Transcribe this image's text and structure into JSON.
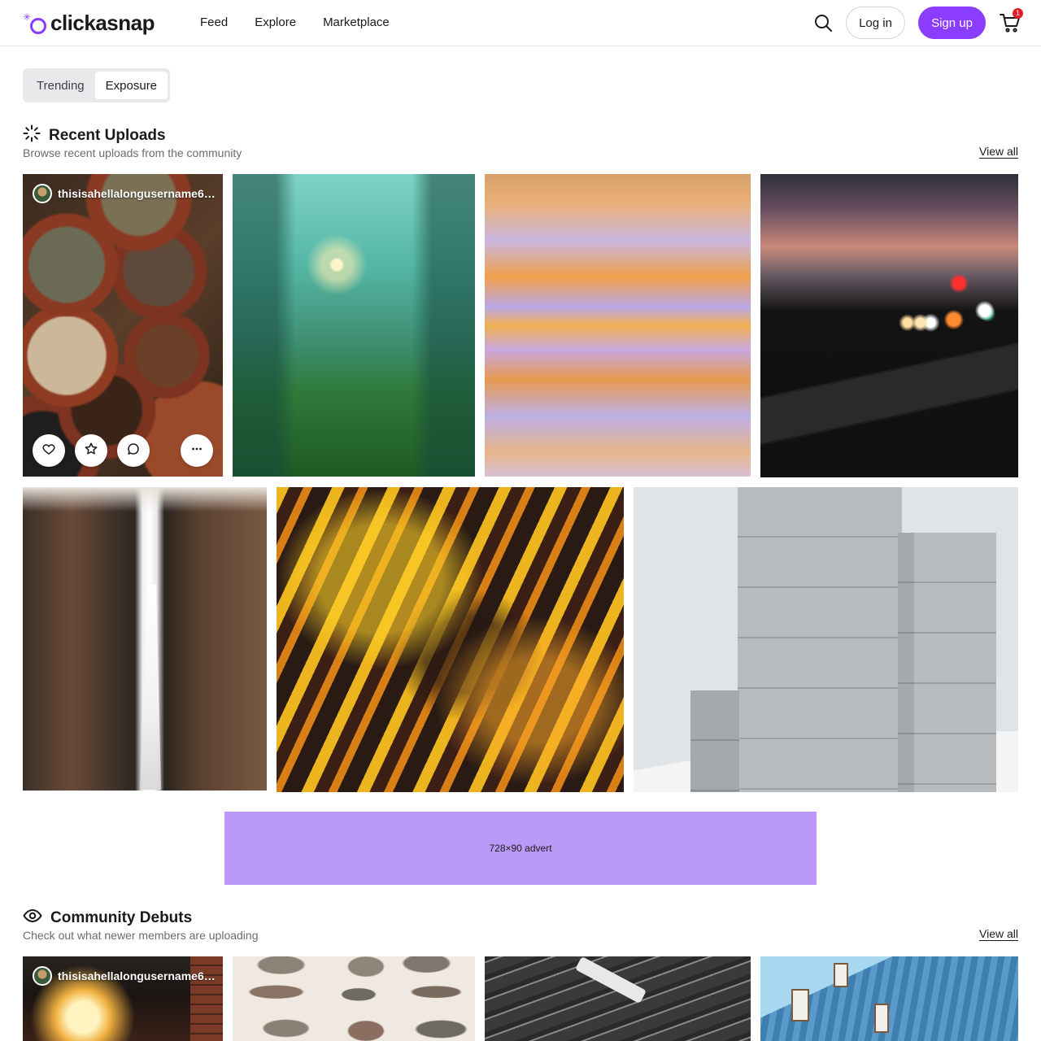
{
  "brand": {
    "name": "clickasnap"
  },
  "nav": {
    "items": [
      {
        "label": "Feed"
      },
      {
        "label": "Explore"
      },
      {
        "label": "Marketplace"
      }
    ]
  },
  "header": {
    "login_label": "Log in",
    "signup_label": "Sign up",
    "cart_count": "1",
    "icons": [
      "search-icon",
      "cart-icon"
    ]
  },
  "tabs": [
    {
      "label": "Trending",
      "active": false
    },
    {
      "label": "Exposure",
      "active": true
    }
  ],
  "recent": {
    "title": "Recent Uploads",
    "subtitle": "Browse recent uploads from the community",
    "view_all": "View all",
    "first_card": {
      "username": "thisisahellalongusername6…",
      "actions": [
        "heart-icon",
        "star-icon",
        "comment-icon",
        "more-icon"
      ]
    },
    "photo_count_row1": 4,
    "photo_count_row2": 3
  },
  "advert": {
    "label": "728×90 advert"
  },
  "debuts": {
    "title": "Community Debuts",
    "subtitle": "Check out what newer members are uploading",
    "view_all": "View all",
    "first_card": {
      "username": "thisisahellalongusername6…"
    }
  },
  "colors": {
    "accent": "#8b3dff",
    "advert_bg": "#bb9af7",
    "badge": "#e11d2a"
  }
}
